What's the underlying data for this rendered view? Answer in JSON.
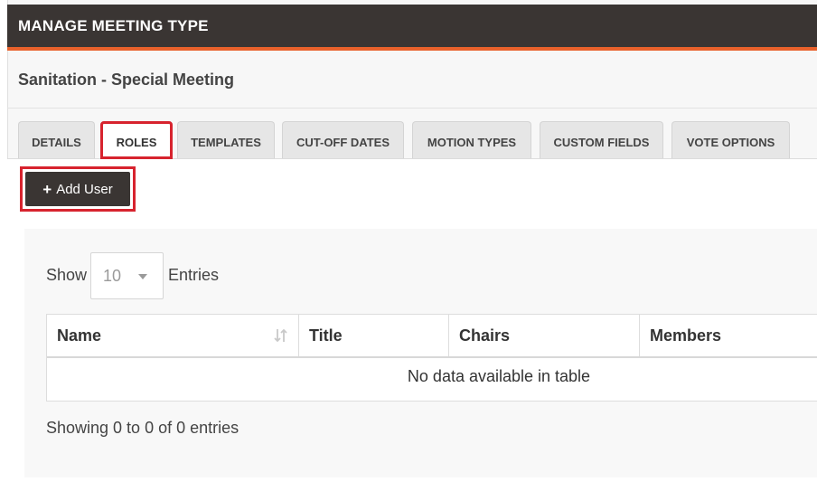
{
  "header": {
    "title": "MANAGE MEETING TYPE"
  },
  "page": {
    "subtitle": "Sanitation - Special Meeting"
  },
  "tabs": [
    {
      "label": "DETAILS",
      "active": false
    },
    {
      "label": "ROLES",
      "active": true
    },
    {
      "label": "TEMPLATES",
      "active": false
    },
    {
      "label": "CUT-OFF DATES",
      "active": false
    },
    {
      "label": "MOTION TYPES",
      "active": false
    },
    {
      "label": "CUSTOM FIELDS",
      "active": false
    },
    {
      "label": "VOTE OPTIONS",
      "active": false
    }
  ],
  "toolbar": {
    "add_user_label": "Add User",
    "add_icon": "plus-icon"
  },
  "table_controls": {
    "show_label": "Show",
    "page_length": "10",
    "entries_label": "Entries"
  },
  "table": {
    "columns": [
      "Name",
      "Title",
      "Chairs",
      "Members"
    ],
    "sort_icon": "sort-icon",
    "empty_message": "No data available in table"
  },
  "info": {
    "text": "Showing 0 to 0 of 0 entries"
  },
  "colors": {
    "header_bg": "#3a3533",
    "accent_orange": "#e9612b",
    "highlight_red": "#d7232e"
  }
}
